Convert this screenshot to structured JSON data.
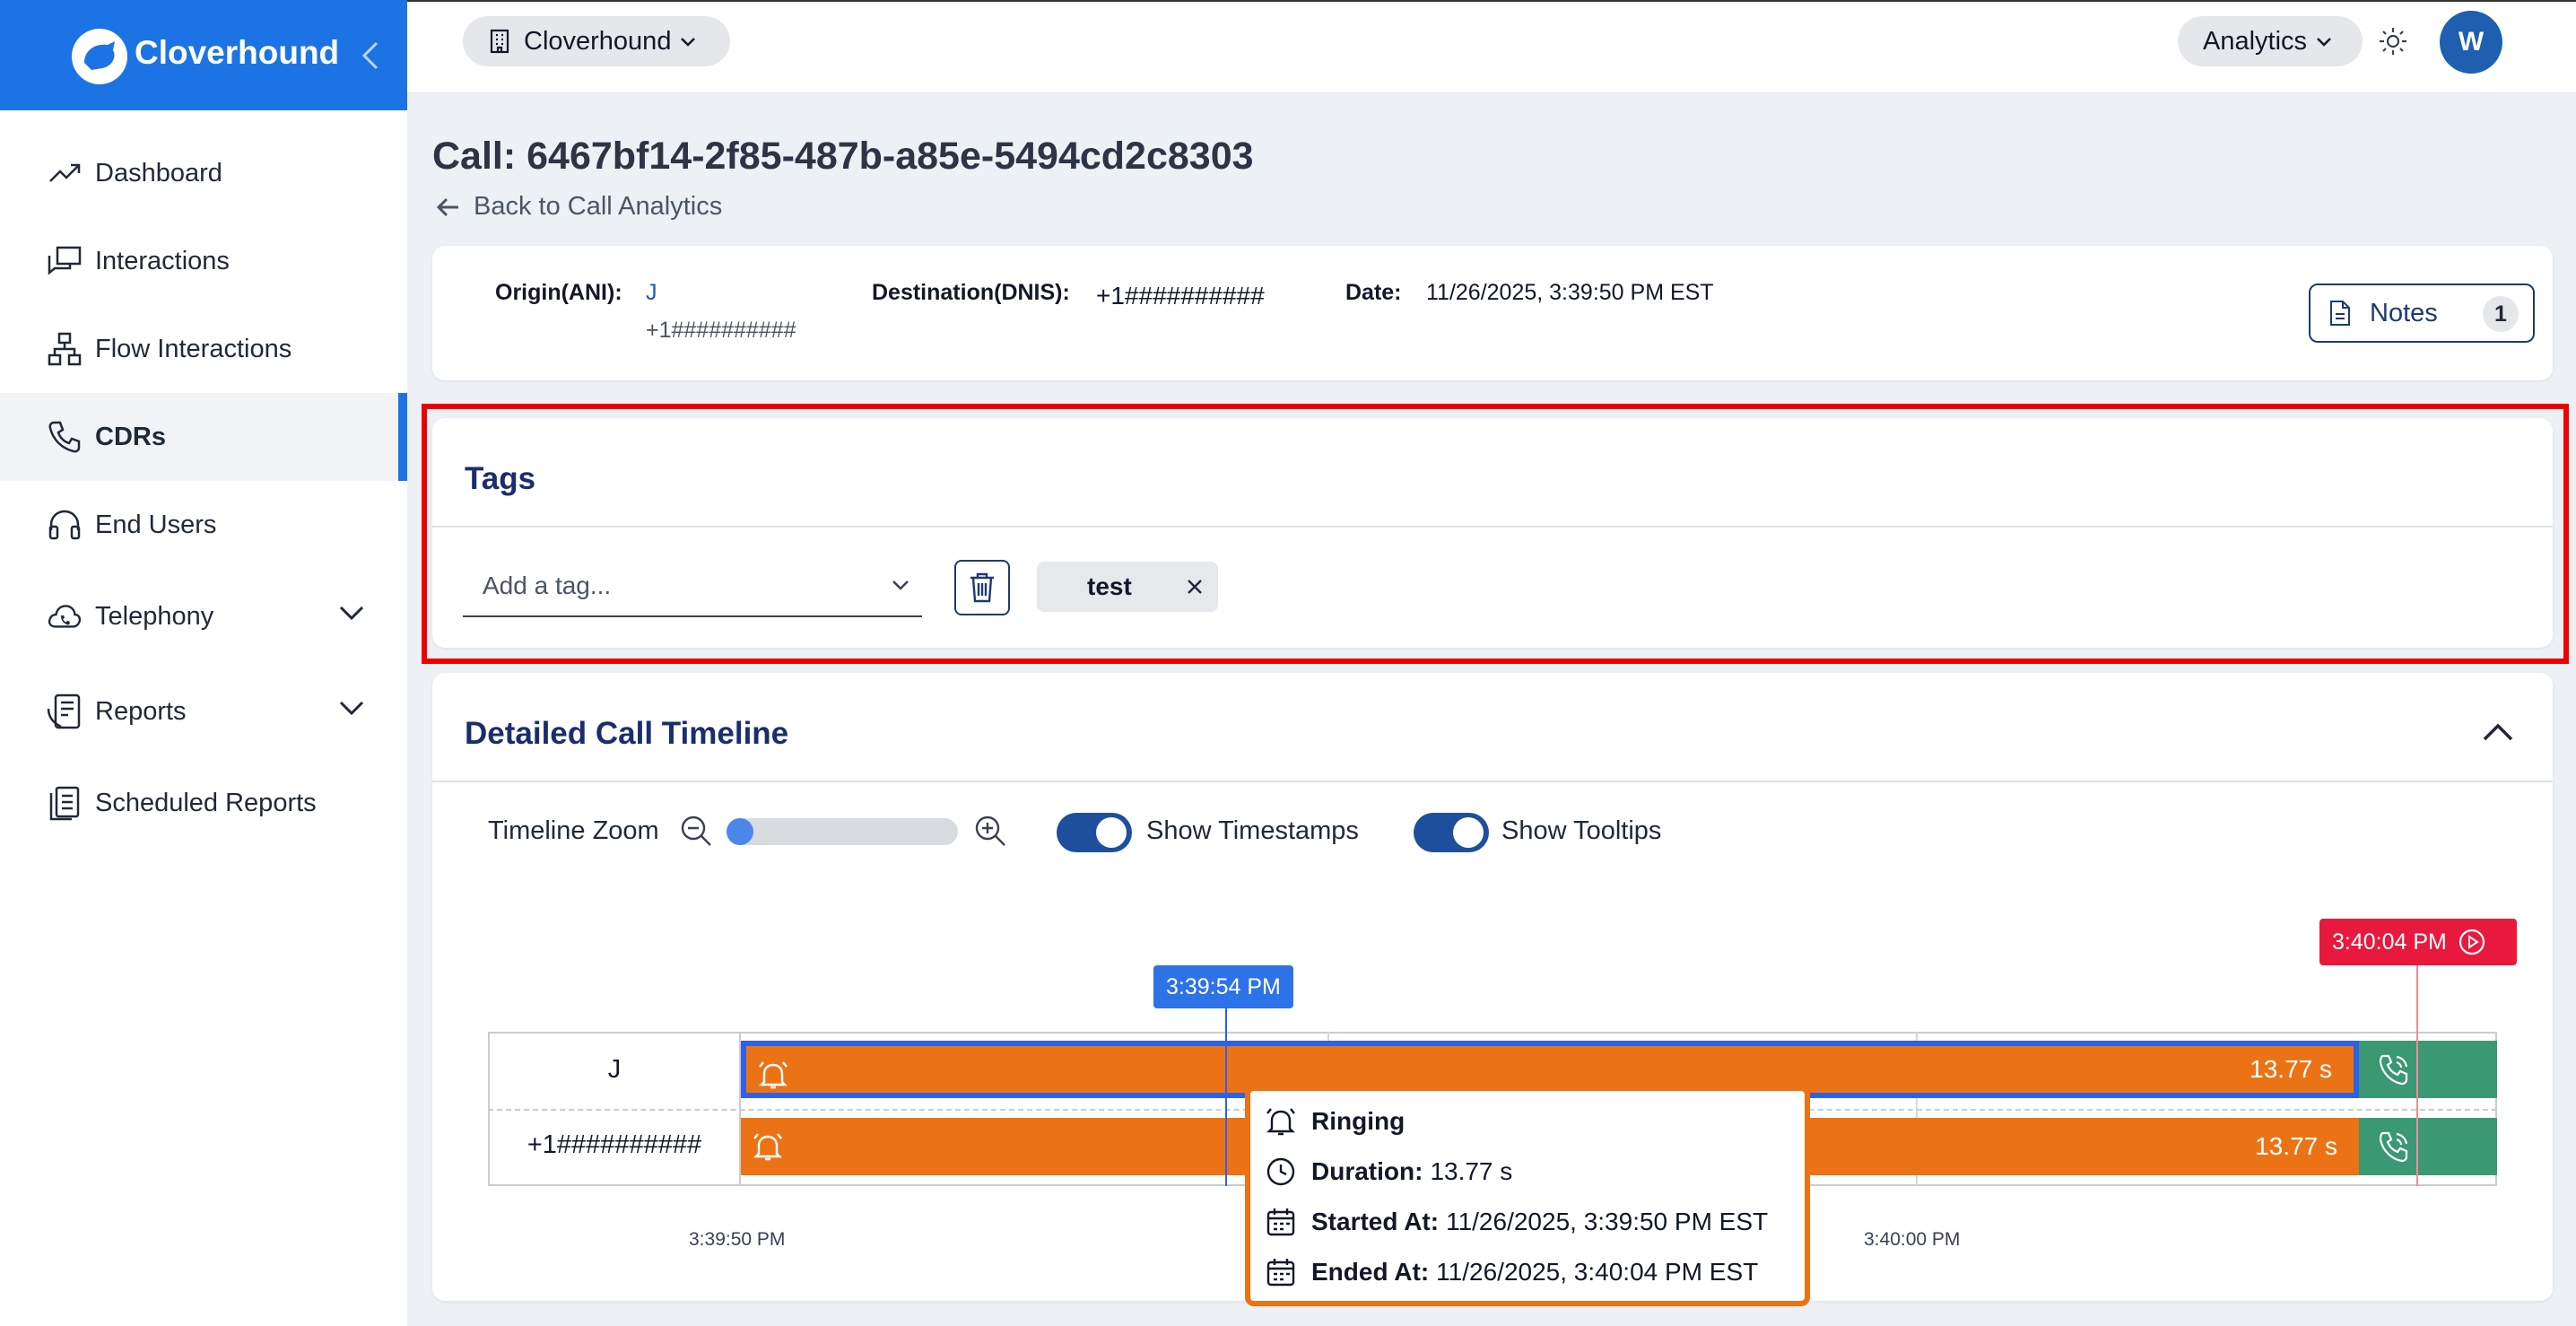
{
  "app": {
    "brand": "Cloverhound"
  },
  "sidebar": {
    "items": [
      {
        "label": "Dashboard",
        "icon": "trend-up-icon"
      },
      {
        "label": "Interactions",
        "icon": "chat-bubbles-icon"
      },
      {
        "label": "Flow Interactions",
        "icon": "flow-chart-icon"
      },
      {
        "label": "CDRs",
        "icon": "phone-icon",
        "active": true
      },
      {
        "label": "End Users",
        "icon": "headset-icon"
      },
      {
        "label": "Telephony",
        "icon": "cloud-phone-icon",
        "expandable": true
      },
      {
        "label": "Reports",
        "icon": "report-phone-icon",
        "expandable": true
      },
      {
        "label": "Scheduled Reports",
        "icon": "clipboard-icon"
      }
    ]
  },
  "topbar": {
    "org": "Cloverhound",
    "analytics": "Analytics",
    "avatar": "W"
  },
  "page": {
    "title": "Call: 6467bf14-2f85-487b-a85e-5494cd2c8303",
    "back": "Back to Call Analytics"
  },
  "call_info": {
    "origin_label": "Origin(ANI):",
    "origin_name": "J",
    "origin_number": "+1##########",
    "destination_label": "Destination(DNIS):",
    "destination_value": "+1##########",
    "date_label": "Date:",
    "date_value": "11/26/2025, 3:39:50 PM EST",
    "notes_label": "Notes",
    "notes_count": "1"
  },
  "tags": {
    "title": "Tags",
    "placeholder": "Add a tag...",
    "items": [
      "test"
    ]
  },
  "timeline": {
    "title": "Detailed Call Timeline",
    "zoom_label": "Timeline Zoom",
    "zoom_level": 0,
    "show_timestamps_label": "Show Timestamps",
    "show_timestamps": true,
    "show_tooltips_label": "Show Tooltips",
    "show_tooltips": true,
    "hover_time": "3:39:54 PM",
    "end_time": "3:40:04 PM",
    "axis_ticks": [
      "3:39:50 PM",
      "3:40:00 PM"
    ],
    "rows": [
      {
        "label": "J",
        "segment": "Ringing",
        "duration": "13.77 s"
      },
      {
        "label": "+1##########",
        "segment": "Ringing",
        "duration": "13.77 s"
      }
    ],
    "tooltip": {
      "title": "Ringing",
      "duration_label": "Duration:",
      "duration_value": "13.77 s",
      "started_label": "Started At:",
      "started_value": "11/26/2025, 3:39:50 PM EST",
      "ended_label": "Ended At:",
      "ended_value": "11/26/2025, 3:40:04 PM EST"
    },
    "colors": {
      "ringing": "#ec7315",
      "connected": "#3a9873",
      "marker": "#2e62e6",
      "end_marker": "#e8193c"
    }
  }
}
